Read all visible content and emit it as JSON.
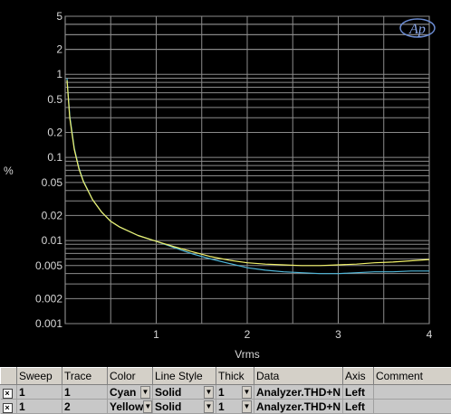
{
  "chart_data": {
    "type": "line",
    "logo": "Ap",
    "xlabel": "Vrms",
    "ylabel": "%",
    "xlim": [
      0,
      4
    ],
    "ylim": [
      0.001,
      5
    ],
    "yscale": "log",
    "x_ticks": [
      "1",
      "2",
      "3",
      "4"
    ],
    "y_ticks": [
      "5",
      "2",
      "1",
      "0.5",
      "0.2",
      "0.1",
      "0.05",
      "0.02",
      "0.01",
      "0.005",
      "0.002",
      "0.001"
    ],
    "grid": true,
    "series": [
      {
        "color": "#4fb6d8",
        "x": [
          0.02,
          0.05,
          0.1,
          0.15,
          0.2,
          0.3,
          0.4,
          0.5,
          0.6,
          0.8,
          1.0,
          1.2,
          1.4,
          1.6,
          1.8,
          2.0,
          2.2,
          2.4,
          2.6,
          2.8,
          3.0,
          3.2,
          3.4,
          3.6,
          3.8,
          4.0
        ],
        "y": [
          0.9,
          0.32,
          0.13,
          0.075,
          0.052,
          0.031,
          0.022,
          0.017,
          0.0145,
          0.0115,
          0.0098,
          0.0082,
          0.0069,
          0.006,
          0.0053,
          0.0047,
          0.0044,
          0.0042,
          0.0041,
          0.004,
          0.004,
          0.0041,
          0.0042,
          0.0042,
          0.0043,
          0.0043
        ]
      },
      {
        "color": "#f0f06a",
        "x": [
          0.02,
          0.05,
          0.1,
          0.15,
          0.2,
          0.3,
          0.4,
          0.5,
          0.6,
          0.8,
          1.0,
          1.2,
          1.4,
          1.6,
          1.8,
          2.0,
          2.2,
          2.4,
          2.6,
          2.8,
          3.0,
          3.2,
          3.4,
          3.6,
          3.8,
          4.0
        ],
        "y": [
          0.85,
          0.3,
          0.125,
          0.073,
          0.051,
          0.031,
          0.022,
          0.017,
          0.0145,
          0.0115,
          0.0098,
          0.0084,
          0.0073,
          0.0064,
          0.0058,
          0.0054,
          0.0052,
          0.0051,
          0.005,
          0.005,
          0.0051,
          0.0052,
          0.0054,
          0.0055,
          0.0057,
          0.0059
        ]
      }
    ]
  },
  "legend_table": {
    "headers": [
      "Sweep",
      "Trace",
      "Color",
      "Line Style",
      "Thick",
      "Data",
      "Axis",
      "Comment"
    ],
    "rows": [
      {
        "checked": "×",
        "sweep": "1",
        "trace": "1",
        "color": "Cyan",
        "line_style": "Solid",
        "thick": "1",
        "data": "Analyzer.THD+N |",
        "axis": "Left",
        "comment": ""
      },
      {
        "checked": "×",
        "sweep": "1",
        "trace": "2",
        "color": "Yellow",
        "line_style": "Solid",
        "thick": "1",
        "data": "Analyzer.THD+N |",
        "axis": "Left",
        "comment": ""
      }
    ]
  }
}
